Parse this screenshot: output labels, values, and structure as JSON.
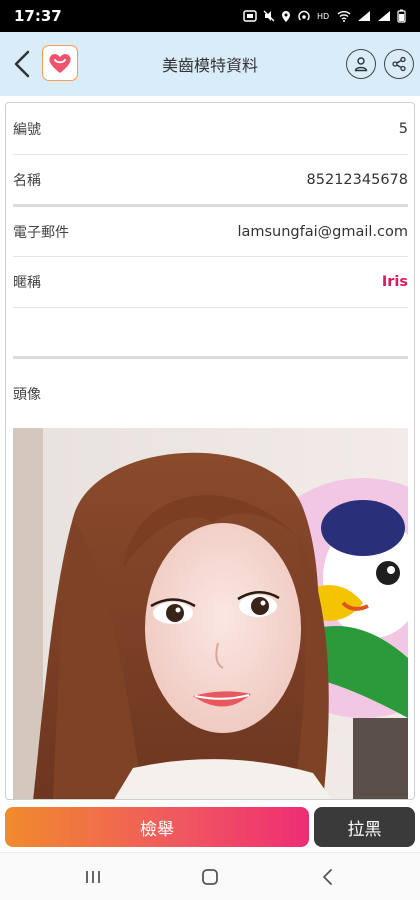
{
  "status_bar": {
    "time": "17:37"
  },
  "header": {
    "title": "美齒模特資料"
  },
  "fields": [
    {
      "label": "編號",
      "value": "5"
    },
    {
      "label": "名稱",
      "value": "85212345678"
    },
    {
      "label": "電子郵件",
      "value": "lamsungfai@gmail.com"
    },
    {
      "label": "暱稱",
      "value": "Iris"
    }
  ],
  "avatar": {
    "label": "頭像"
  },
  "actions": {
    "report_label": "檢舉",
    "block_label": "拉黑"
  },
  "colors": {
    "accent_pink": "#d81b60",
    "header_bg": "#d9ecf9",
    "report_from": "#f08b2c",
    "report_to": "#ee2d74",
    "block_bg": "#3a3a3a"
  }
}
